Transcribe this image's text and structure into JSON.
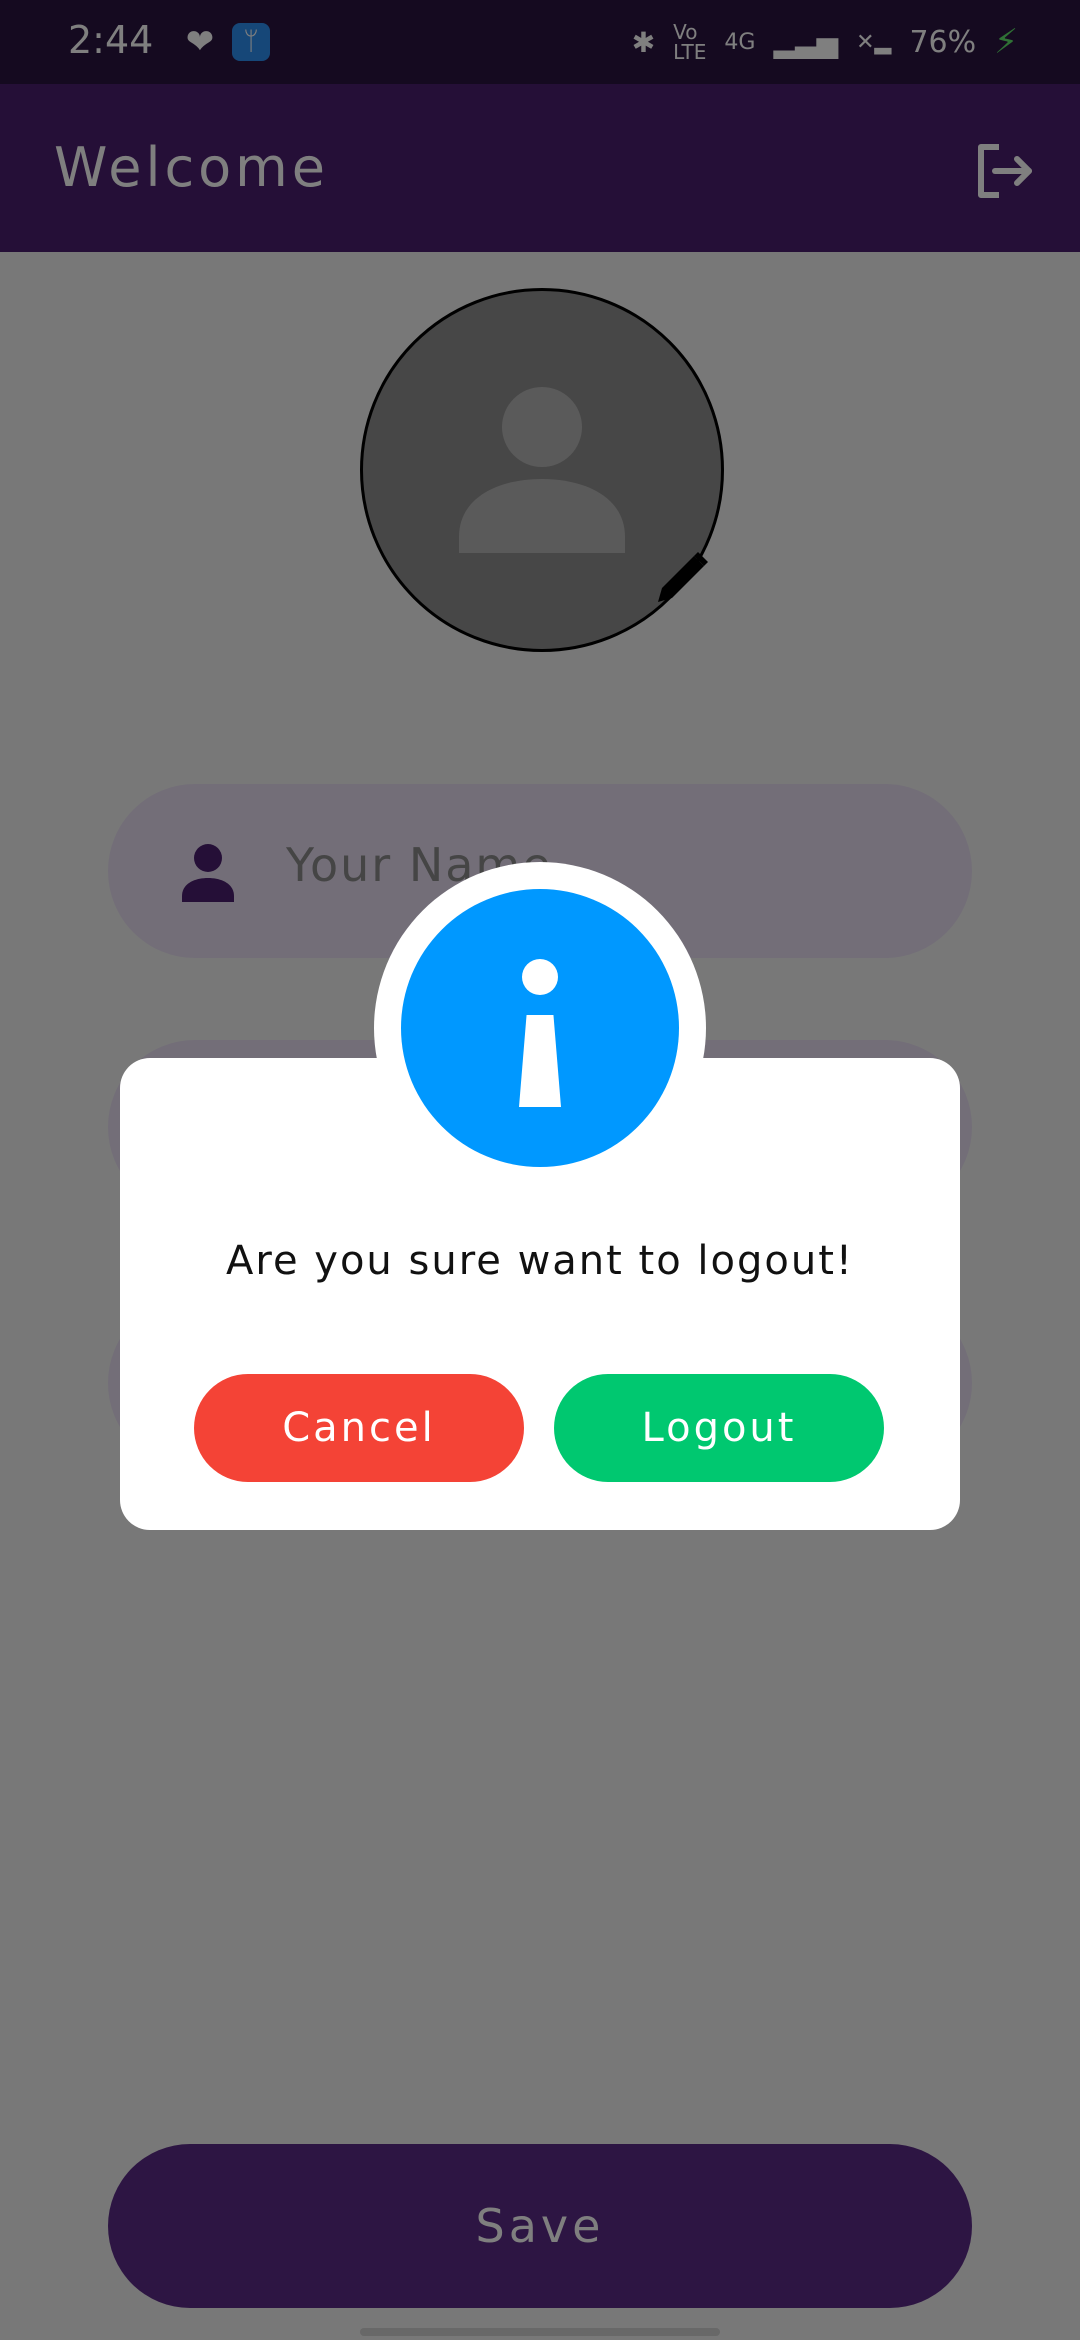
{
  "status_bar": {
    "time": "2:44",
    "network": "4G",
    "battery": "76%",
    "icons": [
      "heart-icon",
      "usb-icon",
      "bluetooth-icon",
      "volte-icon",
      "signal-icon",
      "battery-charging-icon"
    ]
  },
  "appbar": {
    "title": "Welcome",
    "logout_icon": "logout-icon"
  },
  "form": {
    "name_placeholder": "Your Name",
    "save_label": "Save"
  },
  "dialog": {
    "icon": "info-icon",
    "message": "Are you sure want to logout!",
    "cancel_label": "Cancel",
    "logout_label": "Logout"
  },
  "colors": {
    "primary": "#4a1f6f",
    "info": "#0098ff",
    "cancel": "#f44336",
    "confirm": "#00c870"
  }
}
